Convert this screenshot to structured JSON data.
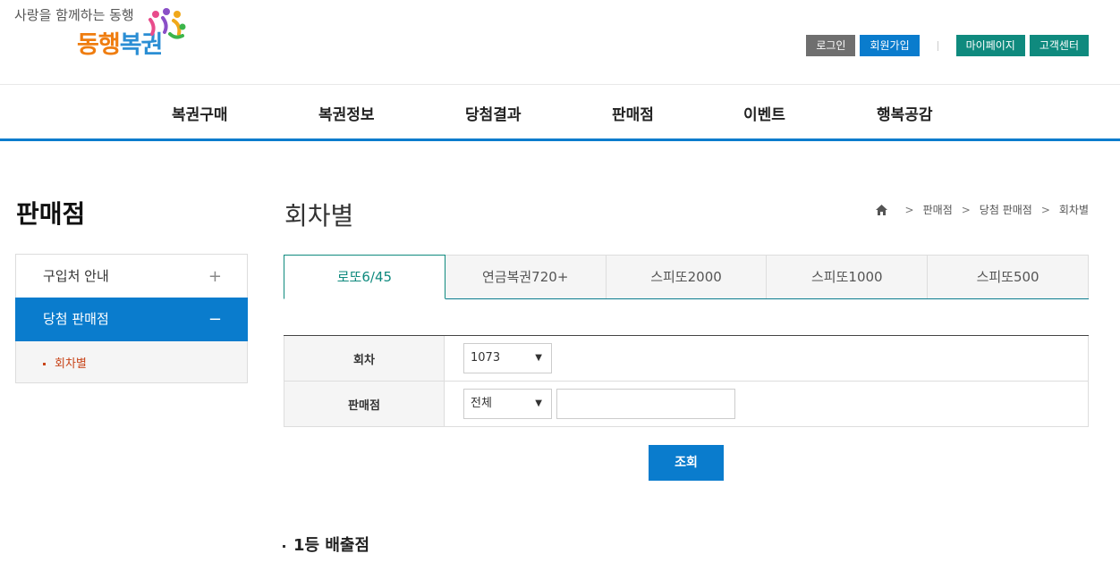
{
  "header": {
    "tagline": "사랑을 함께하는 동행",
    "logo_part1": "동행",
    "logo_part2": "복권",
    "links": {
      "login": "로그인",
      "join": "회원가입",
      "mypage": "마이페이지",
      "support": "고객센터"
    }
  },
  "gnb": {
    "items": [
      "복권구매",
      "복권정보",
      "당첨결과",
      "판매점",
      "이벤트",
      "행복공감"
    ]
  },
  "sidebar": {
    "title": "판매점",
    "items": [
      {
        "label": "구입처 안내",
        "sign": "+"
      },
      {
        "label": "당첨 판매점",
        "sign": "−"
      }
    ],
    "sub_items": [
      "회차별"
    ]
  },
  "main": {
    "title": "회차별",
    "breadcrumb": [
      "판매점",
      "당첨 판매점",
      "회차별"
    ],
    "tabs": [
      "로또6/45",
      "연금복권720+",
      "스피또2000",
      "스피또1000",
      "스피또500"
    ],
    "form": {
      "round_label": "회차",
      "round_value": "1073",
      "store_label": "판매점",
      "region_value": "전체",
      "store_input_value": ""
    },
    "search_button": "조회",
    "section_title": "1등 배출점"
  },
  "colors": {
    "primary_blue": "#0a7ccd",
    "teal": "#0f8a7e",
    "gray_button": "#6f6f6f",
    "accent_red": "#c8451a"
  }
}
